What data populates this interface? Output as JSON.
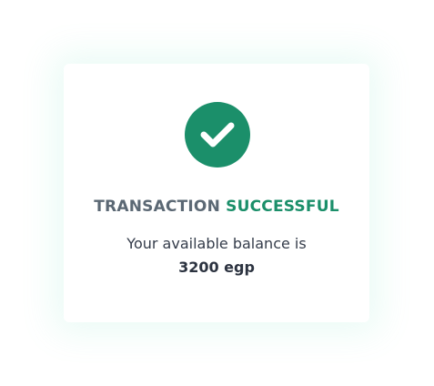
{
  "colors": {
    "accent": "#1b8f6a",
    "title_primary": "#5b6874",
    "text": "#343c4a"
  },
  "card": {
    "icon": "check-circle-icon",
    "title_part1": "TRANSACTION",
    "title_part2": "SUCCESSFUL",
    "balance_text": "Your available balance is",
    "balance_amount": "3200 egp"
  }
}
